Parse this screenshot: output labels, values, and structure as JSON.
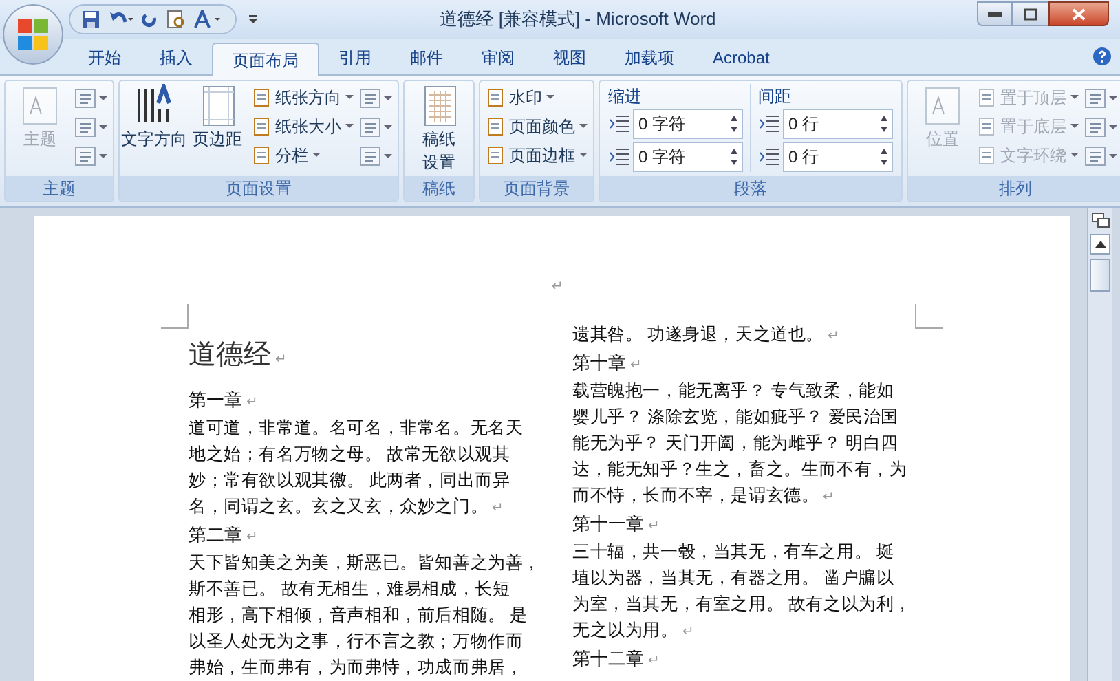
{
  "window": {
    "title": "道德经 [兼容模式] - Microsoft Word"
  },
  "tabs": [
    {
      "label": "开始",
      "selected": false
    },
    {
      "label": "插入",
      "selected": false
    },
    {
      "label": "页面布局",
      "selected": true
    },
    {
      "label": "引用",
      "selected": false
    },
    {
      "label": "邮件",
      "selected": false
    },
    {
      "label": "审阅",
      "selected": false
    },
    {
      "label": "视图",
      "selected": false
    },
    {
      "label": "加载项",
      "selected": false
    },
    {
      "label": "Acrobat",
      "selected": false
    }
  ],
  "ribbon": [
    {
      "label": "主题",
      "items": [
        {
          "kind": "large",
          "lines": [
            "主题"
          ],
          "disabled": true
        },
        {
          "kind": "iconcol"
        }
      ]
    },
    {
      "label": "页面设置",
      "items": [
        {
          "kind": "large",
          "lines": [
            "文字方向"
          ],
          "disabled": false
        },
        {
          "kind": "large",
          "lines": [
            "页边距"
          ],
          "disabled": false
        },
        {
          "kind": "smallcol",
          "entries": [
            "纸张方向",
            "纸张大小",
            "分栏"
          ],
          "disabled": false
        },
        {
          "kind": "iconcol"
        }
      ]
    },
    {
      "label": "稿纸",
      "items": [
        {
          "kind": "large",
          "lines": [
            "稿纸",
            "设置"
          ],
          "disabled": false
        }
      ]
    },
    {
      "label": "页面背景",
      "items": [
        {
          "kind": "smallcol",
          "entries": [
            "水印",
            "页面颜色",
            "页面边框"
          ],
          "disabled": false
        }
      ]
    },
    {
      "label": "段落",
      "items": [
        {
          "kind": "spin",
          "heading": "缩进",
          "values": [
            "0 字符",
            "0 字符"
          ]
        },
        {
          "kind": "spin",
          "heading": "间距",
          "values": [
            "0 行",
            "0 行"
          ]
        }
      ]
    },
    {
      "label": "排列",
      "items": [
        {
          "kind": "large",
          "lines": [
            "位置"
          ],
          "disabled": true
        },
        {
          "kind": "smallcol",
          "entries": [
            "置于顶层",
            "置于底层",
            "文字环绕"
          ],
          "disabled": true
        },
        {
          "kind": "iconcol"
        }
      ]
    }
  ],
  "document": {
    "header_mark": "↵",
    "columns": [
      [
        {
          "kind": "title",
          "lines": [
            "道德经"
          ],
          "mark": "↵"
        },
        {
          "kind": "heading",
          "lines": [
            "第一章"
          ],
          "mark": "↵"
        },
        {
          "kind": "body",
          "lines": [
            "道可道，非常道。名可名，非常名。无名天",
            "地之始；有名万物之母。 故常无欲以观其",
            "妙；常有欲以观其徼。 此两者，同出而异",
            "名，同谓之玄。玄之又玄，众妙之门。"
          ],
          "mark": "↵"
        },
        {
          "kind": "heading",
          "lines": [
            "第二章"
          ],
          "mark": "↵"
        },
        {
          "kind": "body",
          "lines": [
            "天下皆知美之为美，斯恶已。皆知善之为善，",
            "斯不善已。 故有无相生，难易相成，长短",
            "相形，高下相倾，音声相和，前后相随。 是",
            "以圣人处无为之事，行不言之教；万物作而",
            "弗始，生而弗有，为而弗恃，功成而弗居，"
          ]
        }
      ],
      [
        {
          "kind": "body",
          "lines": [
            "遗其咎。 功遂身退，天之道也。"
          ],
          "mark": "↵"
        },
        {
          "kind": "heading",
          "lines": [
            "第十章"
          ],
          "mark": "↵"
        },
        {
          "kind": "body",
          "lines": [
            "载营魄抱一，能无离乎？ 专气致柔，能如",
            "婴儿乎？ 涤除玄览，能如疵乎？ 爱民治国",
            "能无为乎？ 天门开阖，能为雌乎？ 明白四",
            "达，能无知乎？生之，畜之。生而不有，为",
            "而不恃，长而不宰，是谓玄德。"
          ],
          "mark": "↵"
        },
        {
          "kind": "heading",
          "lines": [
            "第十一章"
          ],
          "mark": "↵"
        },
        {
          "kind": "body",
          "lines": [
            "三十辐，共一毂，当其无，有车之用。 埏",
            "埴以为器，当其无，有器之用。 凿户牖以",
            "为室，当其无，有室之用。 故有之以为利，",
            "无之以为用。"
          ],
          "mark": "↵"
        },
        {
          "kind": "heading",
          "lines": [
            "第十二章"
          ],
          "mark": "↵"
        }
      ]
    ]
  }
}
